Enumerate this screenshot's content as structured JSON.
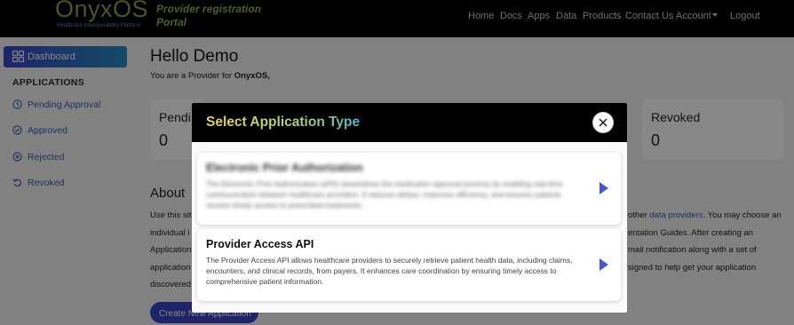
{
  "brand": {
    "logo": "OnyxOS",
    "tagline": "Healthcare Interoperability Platform",
    "portal_title": "Provider registration Portal"
  },
  "nav": {
    "items": [
      "Home",
      "Docs",
      "Apps",
      "Data",
      "Products",
      "Contact Us",
      "Account",
      "Logout"
    ]
  },
  "sidebar": {
    "dashboard_label": "Dashboard",
    "section_title": "APPLICATIONS",
    "items": [
      {
        "label": "Pending Approval",
        "icon": "clock-icon"
      },
      {
        "label": "Approved",
        "icon": "check-circle-icon"
      },
      {
        "label": "Rejected",
        "icon": "x-circle-icon"
      },
      {
        "label": "Revoked",
        "icon": "undo-icon"
      }
    ]
  },
  "main": {
    "greeting": "Hello Demo",
    "role_prefix": "You are a Provider for ",
    "role_org": "OnyxOS,",
    "cards": [
      {
        "title": "Pendi",
        "value": "0"
      },
      {
        "title": "Revoked",
        "value": "0"
      }
    ],
    "about_title": "About",
    "body_left": [
      "Use this sit",
      "individual i",
      "Application",
      "application",
      "discovered"
    ],
    "body_right_1_text": "other ",
    "body_right_1_link": "data providers",
    "body_right_1_tail": ". You may choose an",
    "body_right_2": "entation Guides. After creating an",
    "body_right_3": "mail notification along with a set of",
    "body_right_4": "signed to help get your application",
    "create_button": "Create New Application"
  },
  "modal": {
    "title": "Select Application Type",
    "options": [
      {
        "title": "Electronic Prior Authorization",
        "description": "The Electronic Prior Authorization (ePA) streamlines the medication approval process by enabling real-time communication between healthcare providers. It reduces delays, improves efficiency, and ensures patients receive timely access to prescribed treatments."
      },
      {
        "title": "Provider Access API",
        "description": "The Provider Access API allows healthcare providers to securely retrieve patient health data, including claims, encounters, and clinical records, from payers. It enhances care coordination by ensuring timely access to comprehensive patient information."
      }
    ]
  },
  "colors": {
    "accent": "#3b44c4",
    "arrow": "#4a54d8",
    "link": "#3a5fb0"
  }
}
